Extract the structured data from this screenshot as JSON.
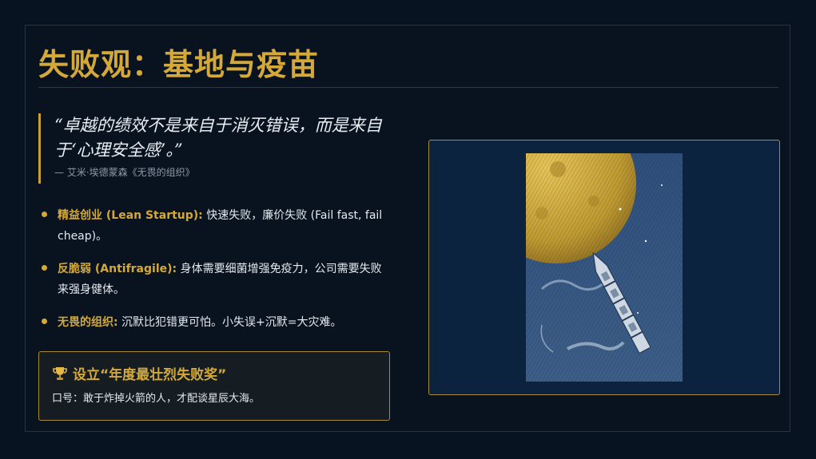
{
  "slide": {
    "title": "失败观：基地与疫苗",
    "quote": {
      "text": "“卓越的绩效不是来自于消灭错误，而是来自于‘心理安全感’。”",
      "source": "— 艾米·埃德蒙森《无畏的组织》"
    },
    "bullets": [
      {
        "term": "精益创业 (Lean Startup):",
        "text": " 快速失败，廉价失败 (Fail fast, fail cheap)。"
      },
      {
        "term": "反脆弱 (Antifragile):",
        "text": " 身体需要细菌增强免疫力，公司需要失败来强身健体。"
      },
      {
        "term": "无畏的组织:",
        "text": " 沉默比犯错更可怕。小失误+沉默=大灾难。"
      }
    ],
    "award": {
      "icon": "trophy-icon",
      "title": "设立“年度最壮烈失败奖”",
      "text": "口号：敢于炸掉火箭的人，才配谈星辰大海。"
    },
    "illustration": "moon-rocket-engraving",
    "colors": {
      "accent": "#d4a93a",
      "background": "#081322",
      "frame": "#0c2340"
    }
  }
}
